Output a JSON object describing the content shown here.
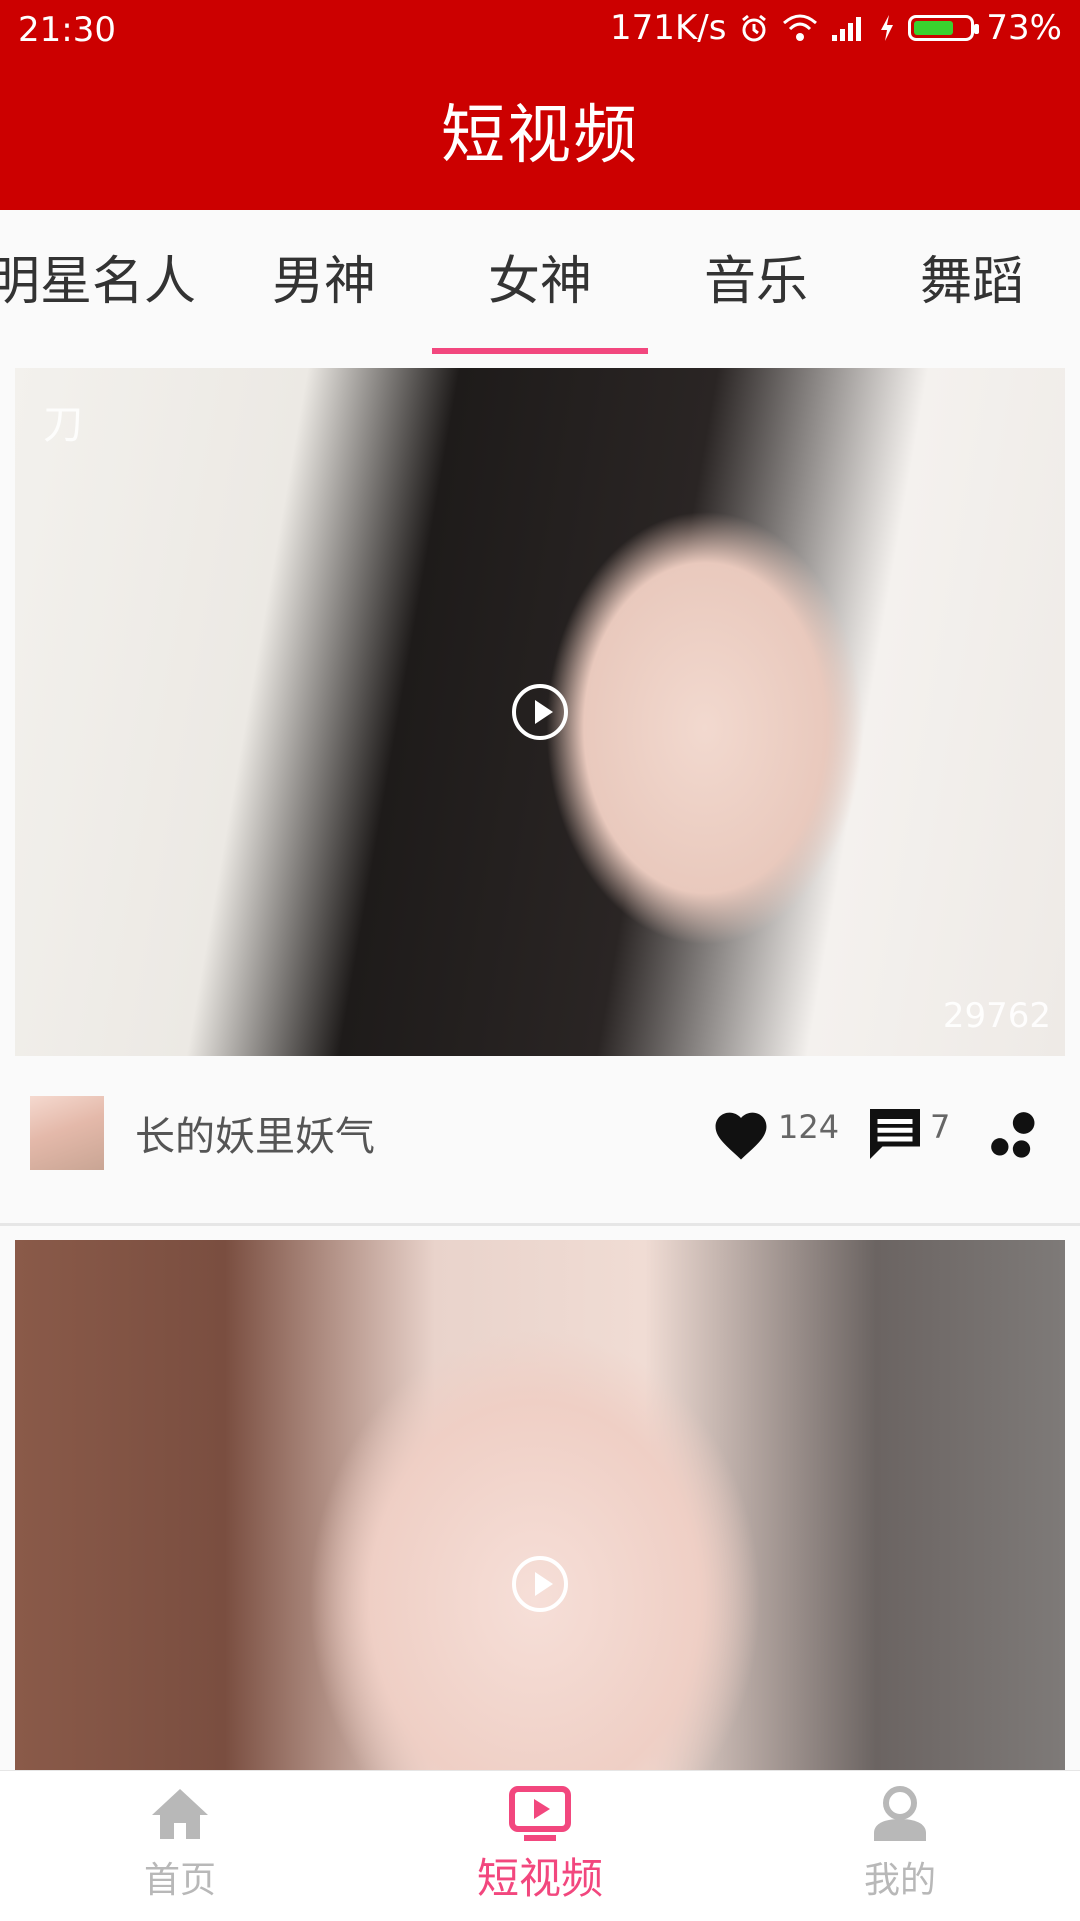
{
  "status_bar": {
    "time": "21:30",
    "net_speed": "171K/s",
    "battery_percent": "73%",
    "battery_level": 0.73,
    "icons": [
      "alarm-icon",
      "wifi-icon",
      "signal-icon",
      "charging-icon",
      "battery-icon"
    ]
  },
  "header": {
    "title": "短视频"
  },
  "tabs": [
    {
      "label": "明星名人"
    },
    {
      "label": "男神"
    },
    {
      "label": "女神",
      "active": true
    },
    {
      "label": "音乐"
    },
    {
      "label": "舞蹈"
    }
  ],
  "feed": [
    {
      "caption": "刀",
      "views": "29762",
      "author": "长的妖里妖气",
      "likes": "124",
      "comments": "7"
    },
    {
      "caption": "",
      "views": "",
      "author": "",
      "likes": "",
      "comments": ""
    }
  ],
  "bottom_nav": [
    {
      "label": "首页",
      "icon": "home-icon"
    },
    {
      "label": "短视频",
      "icon": "video-icon",
      "active": true
    },
    {
      "label": "我的",
      "icon": "profile-icon"
    }
  ],
  "colors": {
    "brand_red": "#cc0000",
    "accent_pink": "#f2477e",
    "inactive_gray": "#b8b8b8"
  }
}
